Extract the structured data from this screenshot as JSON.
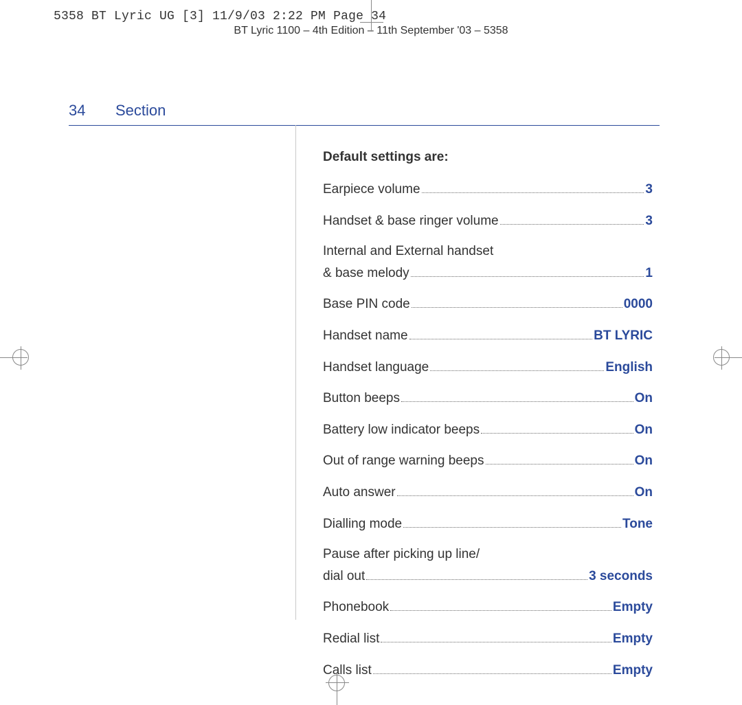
{
  "print_tag": "5358 BT Lyric UG [3]  11/9/03  2:22 PM  Page 34",
  "doc_header": "BT Lyric 1100 – 4th Edition – 11th September '03 – 5358",
  "page_number": "34",
  "section_title": "Section",
  "heading": "Default settings are:",
  "settings": [
    {
      "label": "Earpiece volume",
      "value": "3"
    },
    {
      "label": "Handset & base ringer volume",
      "value": "3"
    },
    {
      "label": "Internal and External handset",
      "label2": "& base melody",
      "value": "1",
      "multiline": true
    },
    {
      "label": "Base PIN code",
      "value": "0000"
    },
    {
      "label": "Handset name",
      "value": "BT LYRIC"
    },
    {
      "label": "Handset language",
      "value": "English"
    },
    {
      "label": "Button beeps",
      "value": "On"
    },
    {
      "label": "Battery low indicator beeps",
      "value": "On"
    },
    {
      "label": "Out of range warning beeps",
      "value": "On"
    },
    {
      "label": "Auto answer",
      "value": "On"
    },
    {
      "label": "Dialling mode",
      "value": "Tone"
    },
    {
      "label": "Pause after picking up line/",
      "label2": "dial out",
      "value": "3 seconds",
      "multiline": true
    },
    {
      "label": "Phonebook",
      "value": "Empty"
    },
    {
      "label": "Redial list",
      "value": "Empty"
    },
    {
      "label": "Calls list",
      "value": "Empty"
    }
  ]
}
